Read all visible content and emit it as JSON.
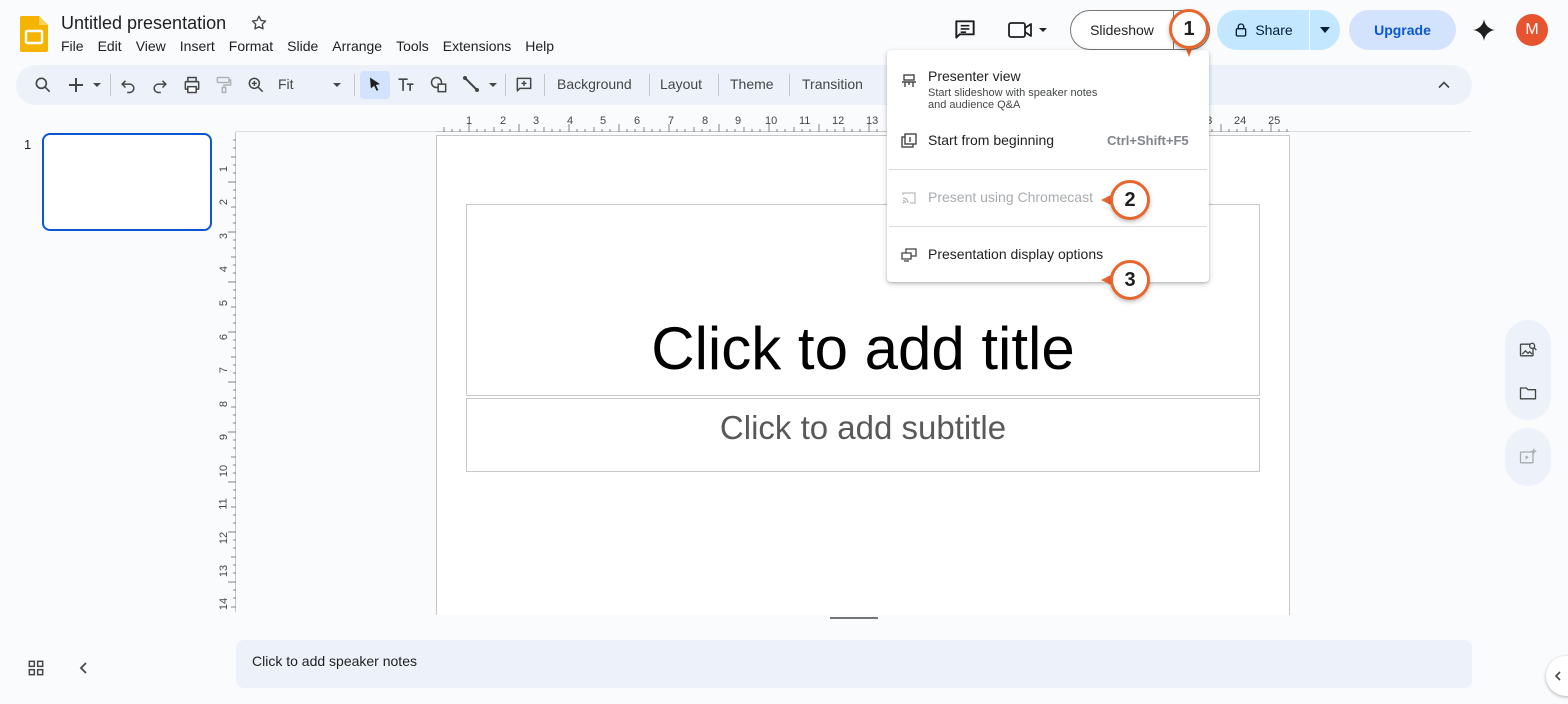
{
  "app": {
    "doc_title": "Untitled presentation",
    "menus": [
      "File",
      "Edit",
      "View",
      "Insert",
      "Format",
      "Slide",
      "Arrange",
      "Tools",
      "Extensions",
      "Help"
    ]
  },
  "header": {
    "slideshow_label": "Slideshow",
    "share_label": "Share",
    "upgrade_label": "Upgrade",
    "avatar_initial": "M"
  },
  "toolbar": {
    "zoom_value": "Fit",
    "background_label": "Background",
    "layout_label": "Layout",
    "theme_label": "Theme",
    "transition_label": "Transition"
  },
  "ruler": {
    "h_labels": [
      "1",
      "2",
      "3",
      "4",
      "5",
      "6",
      "7",
      "8",
      "9",
      "10",
      "11",
      "12",
      "13",
      "23",
      "24",
      "25"
    ],
    "v_labels": [
      "1",
      "2",
      "3",
      "4",
      "5",
      "6",
      "7",
      "8",
      "9",
      "10",
      "11",
      "12",
      "13",
      "14"
    ]
  },
  "filmstrip": {
    "slide_number": "1"
  },
  "slide": {
    "title_placeholder": "Click to add title",
    "subtitle_placeholder": "Click to add subtitle"
  },
  "notes": {
    "placeholder": "Click to add speaker notes"
  },
  "slideshow_menu": {
    "items": [
      {
        "label": "Presenter view",
        "description_line1": "Start slideshow with speaker notes",
        "description_line2": "and audience Q&A",
        "icon": "presenter-view-icon"
      },
      {
        "label": "Start from beginning",
        "shortcut": "Ctrl+Shift+F5",
        "icon": "start-beginning-icon"
      },
      {
        "label": "Present using Chromecast",
        "disabled": true,
        "icon": "cast-icon"
      },
      {
        "label": "Presentation display options",
        "icon": "display-options-icon"
      }
    ]
  },
  "annotations": [
    "1",
    "2",
    "3"
  ],
  "colors": {
    "accent_orange": "#e8662c",
    "selection_blue": "#0b57d0",
    "share_bg": "#c2e7ff",
    "upgrade_bg": "#d3e3fd",
    "toolbar_bg": "#edf2fa"
  }
}
